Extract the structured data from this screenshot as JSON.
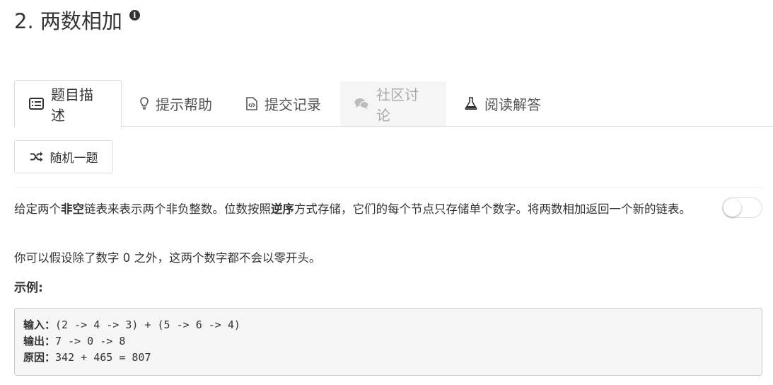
{
  "problem": {
    "title": "2. 两数相加",
    "info_icon": "info-circle-icon"
  },
  "tabs": [
    {
      "label": "题目描述",
      "icon": "list-alt-icon",
      "state": "active"
    },
    {
      "label": "提示帮助",
      "icon": "lightbulb-icon",
      "state": "normal"
    },
    {
      "label": "提交记录",
      "icon": "code-file-icon",
      "state": "normal"
    },
    {
      "label": "社区讨论",
      "icon": "comments-icon",
      "state": "disabled"
    },
    {
      "label": "阅读解答",
      "icon": "flask-icon",
      "state": "normal"
    }
  ],
  "random_button": {
    "label": "随机一题",
    "icon": "shuffle-icon"
  },
  "description": {
    "p1_a": "给定两个",
    "p1_b": "非空",
    "p1_c": "链表来表示两个非负整数。位数按照",
    "p1_d": "逆序",
    "p1_e": "方式存储，它们的每个节点只存储单个数字。将两数相加返回一个新的链表。",
    "p2": "你可以假设除了数字 0 之外，这两个数字都不会以零开头。",
    "example_label": "示例:"
  },
  "example": {
    "lines": [
      {
        "key": "输入：",
        "value": "(2 -> 4 -> 3) + (5 -> 6 -> 4)"
      },
      {
        "key": "输出：",
        "value": "7 -> 0 -> 8"
      },
      {
        "key": "原因：",
        "value": "342 + 465 = 807"
      }
    ]
  },
  "toggle": {
    "on": false
  }
}
